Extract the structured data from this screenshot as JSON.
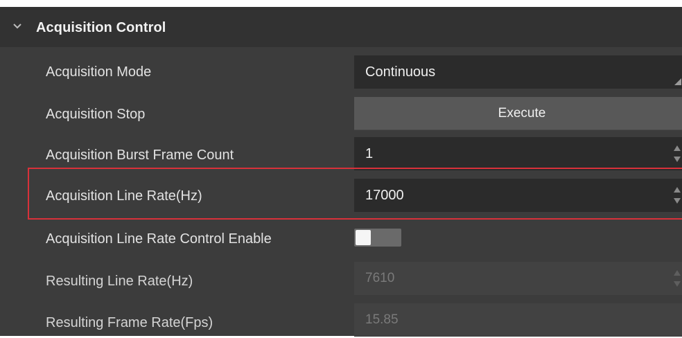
{
  "section": {
    "title": "Acquisition Control",
    "icon": "chevron-down-icon",
    "expanded": true
  },
  "rows": [
    {
      "label": "Acquisition Mode",
      "value": "Continuous",
      "kind": "combo"
    },
    {
      "label": "Acquisition Stop",
      "value": "Execute",
      "kind": "button"
    },
    {
      "label": "Acquisition Burst Frame Count",
      "value": "1",
      "kind": "spinbox"
    },
    {
      "label": "Acquisition Line Rate(Hz)",
      "value": "17000",
      "kind": "spinbox",
      "highlighted": true
    },
    {
      "label": "Acquisition Line Rate Control Enable",
      "value": false,
      "kind": "toggle"
    },
    {
      "label": "Resulting Line Rate(Hz)",
      "value": "7610",
      "kind": "spinbox",
      "disabled": true
    },
    {
      "label": "Resulting Frame Rate(Fps)",
      "value": "15.85",
      "kind": "readonly",
      "disabled": true
    }
  ],
  "colors": {
    "panel_bg": "#3c3c3c",
    "header_bg": "#323232",
    "field_bg": "#2b2b2b",
    "button_bg": "#585858",
    "highlight_border": "#d9313a"
  }
}
